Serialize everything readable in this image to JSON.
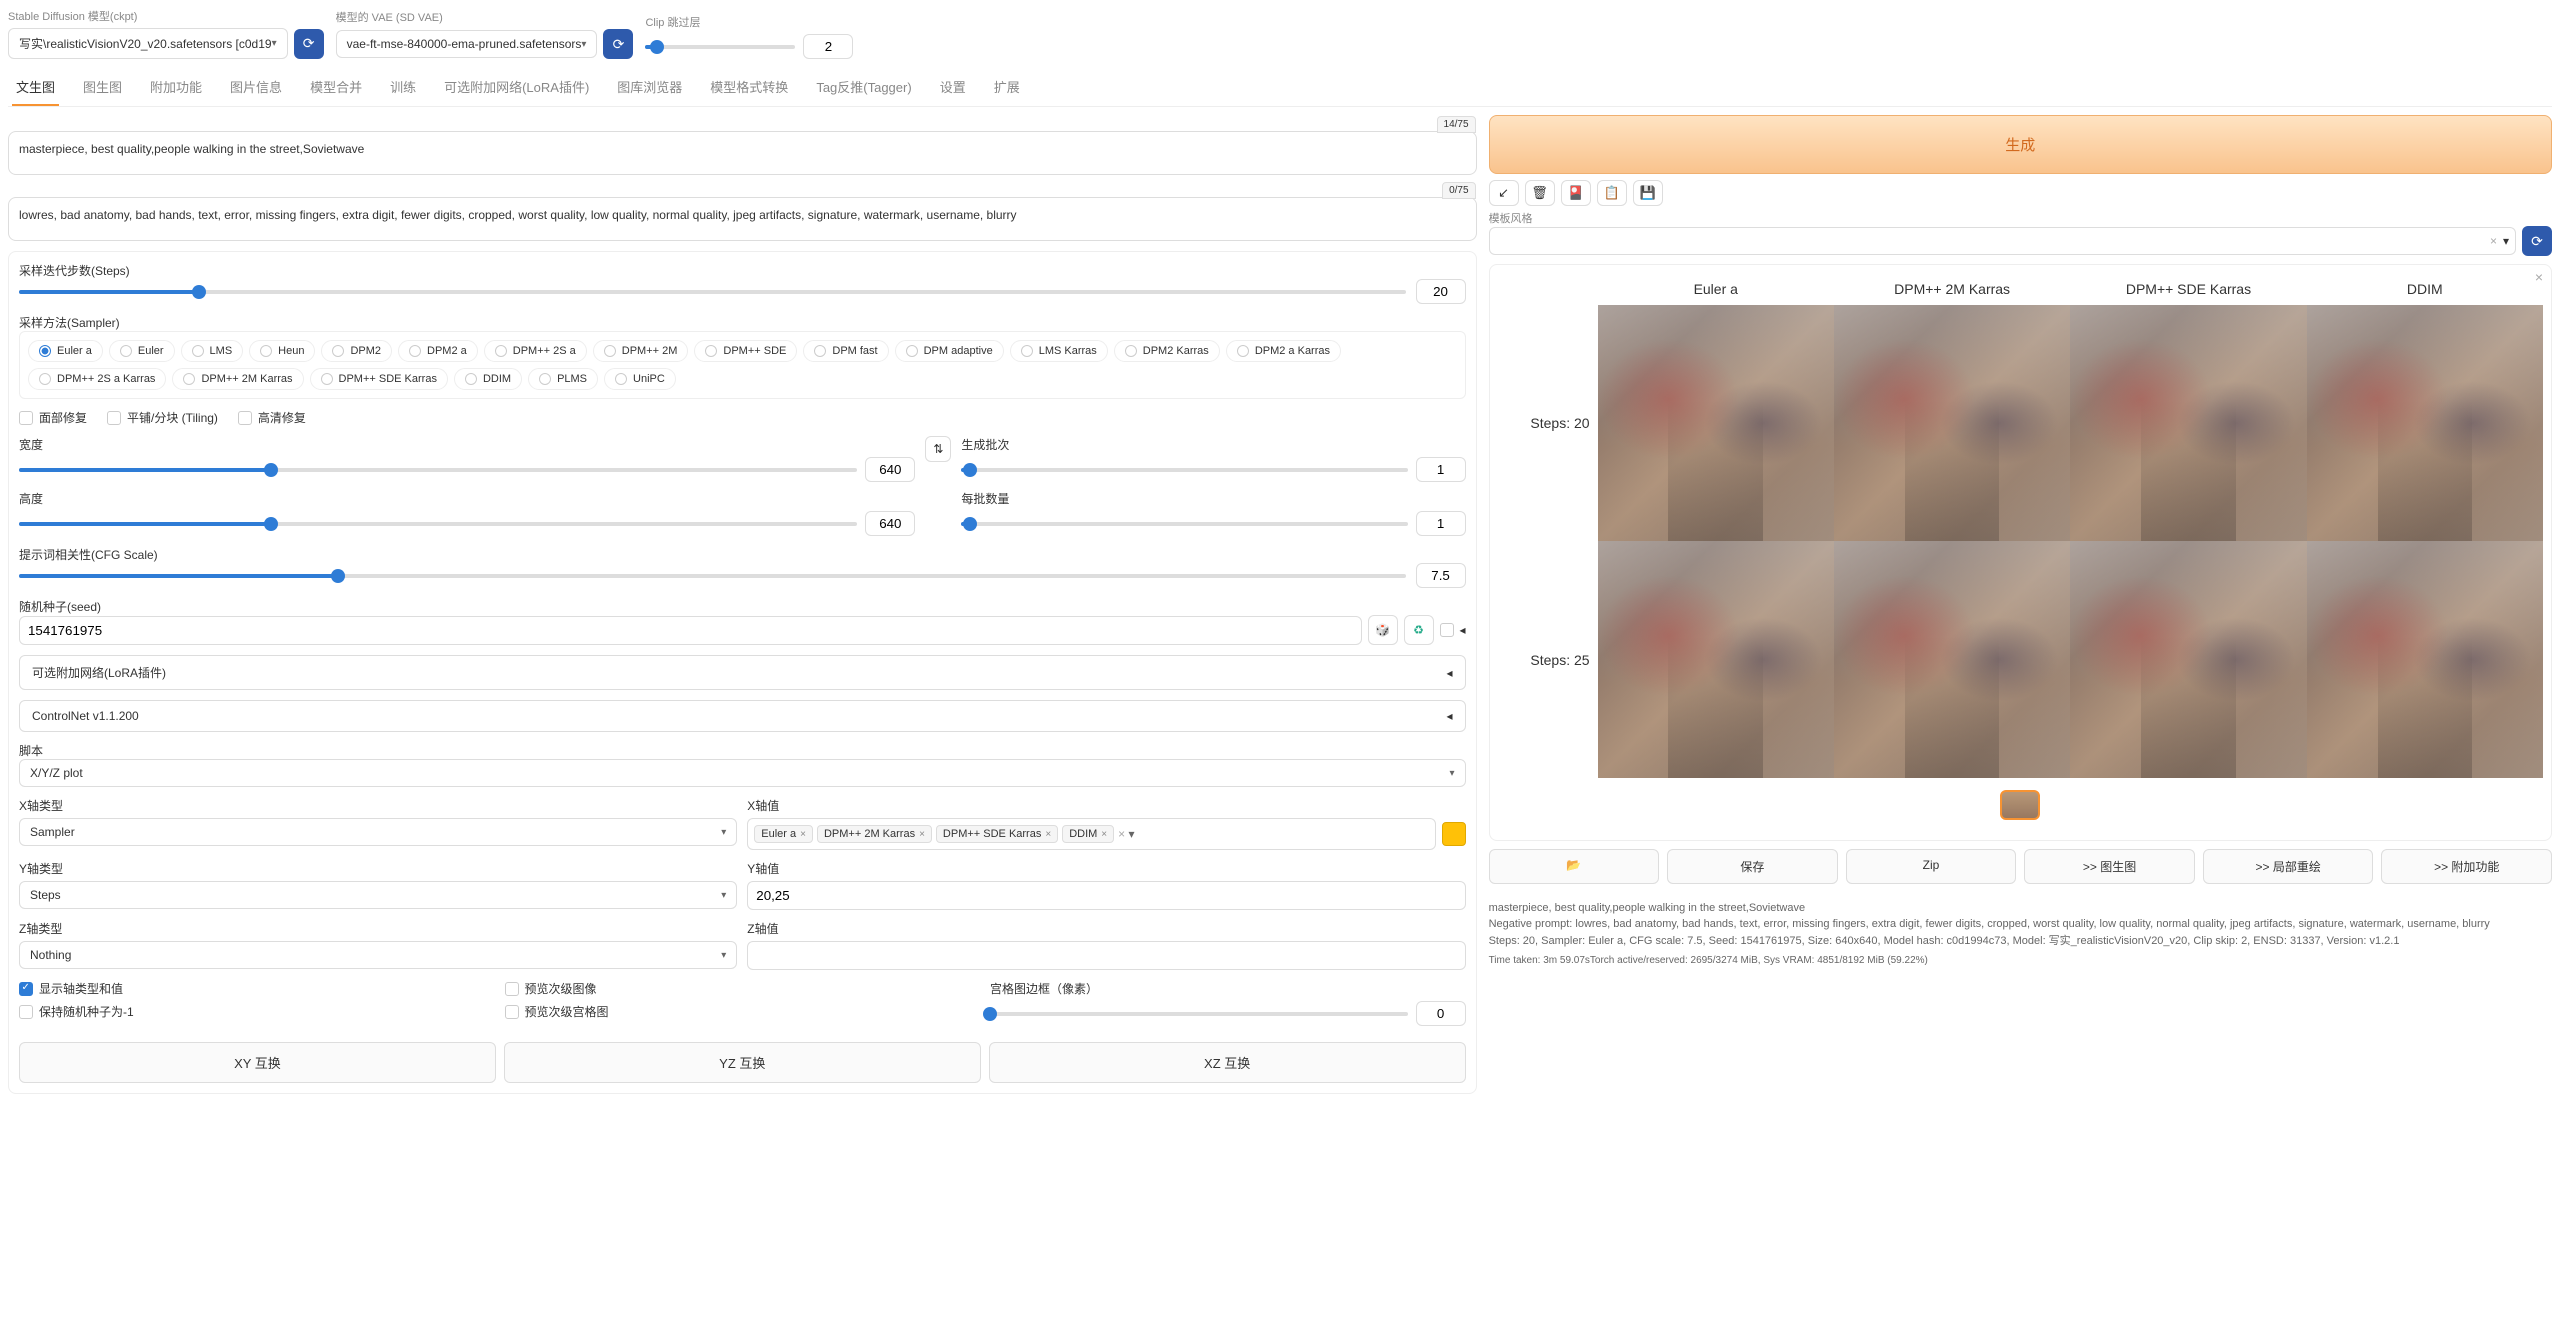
{
  "topbar": {
    "ckpt_label": "Stable Diffusion 模型(ckpt)",
    "ckpt_value": "写实\\realisticVisionV20_v20.safetensors [c0d19",
    "vae_label": "模型的 VAE (SD VAE)",
    "vae_value": "vae-ft-mse-840000-ema-pruned.safetensors",
    "clip_label": "Clip 跳过层",
    "clip_value": "2"
  },
  "tabs": [
    "文生图",
    "图生图",
    "附加功能",
    "图片信息",
    "模型合并",
    "训练",
    "可选附加网络(LoRA插件)",
    "图库浏览器",
    "模型格式转换",
    "Tag反推(Tagger)",
    "设置",
    "扩展"
  ],
  "prompt": {
    "positive": "masterpiece, best quality,people walking in the street,Sovietwave",
    "pos_count": "14/75",
    "negative": "lowres, bad anatomy, bad hands, text, error, missing fingers, extra digit, fewer digits, cropped, worst quality, low quality, normal quality, jpeg artifacts, signature, watermark, username, blurry",
    "neg_count": "0/75"
  },
  "generate": "生成",
  "template_label": "模板风格",
  "settings": {
    "steps_label": "采样迭代步数(Steps)",
    "steps": "20",
    "sampler_label": "采样方法(Sampler)",
    "samplers": [
      "Euler a",
      "Euler",
      "LMS",
      "Heun",
      "DPM2",
      "DPM2 a",
      "DPM++ 2S a",
      "DPM++ 2M",
      "DPM++ SDE",
      "DPM fast",
      "DPM adaptive",
      "LMS Karras",
      "DPM2 Karras",
      "DPM2 a Karras",
      "DPM++ 2S a Karras",
      "DPM++ 2M Karras",
      "DPM++ SDE Karras",
      "DDIM",
      "PLMS",
      "UniPC"
    ],
    "face_restore": "面部修复",
    "tiling": "平铺/分块 (Tiling)",
    "hires": "高清修复",
    "width_label": "宽度",
    "width": "640",
    "height_label": "高度",
    "height": "640",
    "batch_count_label": "生成批次",
    "batch_count": "1",
    "batch_size_label": "每批数量",
    "batch_size": "1",
    "cfg_label": "提示词相关性(CFG Scale)",
    "cfg": "7.5",
    "seed_label": "随机种子(seed)",
    "seed": "1541761975",
    "lora_label": "可选附加网络(LoRA插件)",
    "controlnet_label": "ControlNet v1.1.200",
    "script_label": "脚本",
    "script_value": "X/Y/Z plot",
    "x_type_label": "X轴类型",
    "x_type": "Sampler",
    "x_values_label": "X轴值",
    "x_tokens": [
      "Euler a",
      "DPM++ 2M Karras",
      "DPM++ SDE Karras",
      "DDIM"
    ],
    "y_type_label": "Y轴类型",
    "y_type": "Steps",
    "y_values_label": "Y轴值",
    "y_values": "20,25",
    "z_type_label": "Z轴类型",
    "z_type": "Nothing",
    "z_values_label": "Z轴值",
    "show_axis": "显示轴类型和值",
    "include_sub": "预览次级图像",
    "keep_seed": "保持随机种子为-1",
    "include_sub_grid": "预览次级宫格图",
    "margin_label": "宫格图边框（像素）",
    "margin": "0",
    "xy_swap": "XY 互换",
    "yz_swap": "YZ 互换",
    "xz_swap": "XZ 互换"
  },
  "output": {
    "col_headers": [
      "Euler a",
      "DPM++ 2M Karras",
      "DPM++ SDE Karras",
      "DDIM"
    ],
    "row_labels": [
      "Steps: 20",
      "Steps: 25"
    ],
    "actions": {
      "folder": "📂",
      "save": "保存",
      "zip": "Zip",
      "img2img": ">> 图生图",
      "inpaint": ">> 局部重绘",
      "extras": ">> 附加功能"
    }
  },
  "info": {
    "line1": "masterpiece, best quality,people walking in the street,Sovietwave",
    "line2": "Negative prompt: lowres, bad anatomy, bad hands, text, error, missing fingers, extra digit, fewer digits, cropped, worst quality, low quality, normal quality, jpeg artifacts, signature, watermark, username, blurry",
    "line3": "Steps: 20, Sampler: Euler a, CFG scale: 7.5, Seed: 1541761975, Size: 640x640, Model hash: c0d1994c73, Model: 写实_realisticVisionV20_v20, Clip skip: 2, ENSD: 31337, Version: v1.2.1",
    "line4": "Time taken: 3m 59.07sTorch active/reserved: 2695/3274 MiB, Sys VRAM: 4851/8192 MiB (59.22%)"
  }
}
